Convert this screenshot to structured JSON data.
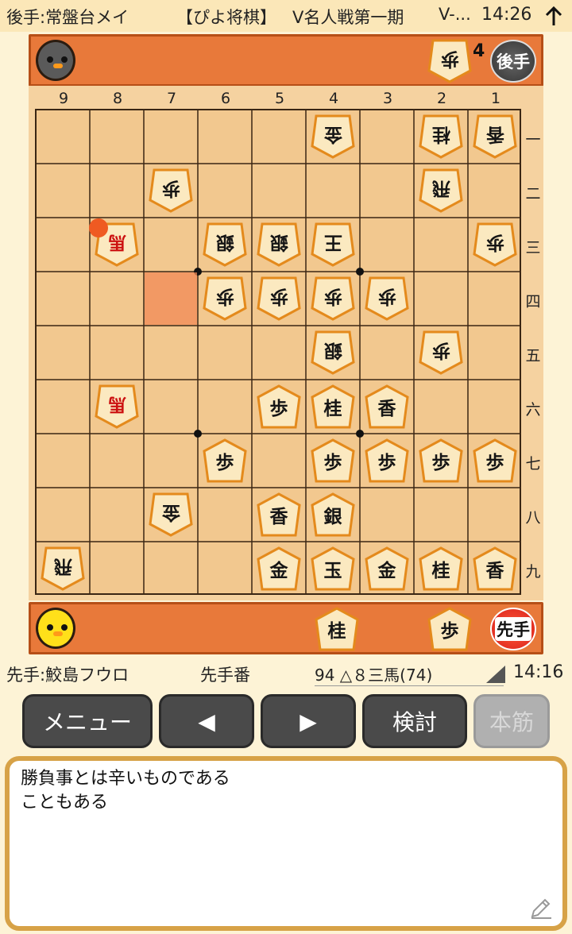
{
  "status_bar": {
    "gote_player": "後手:常盤台メイ",
    "app_title": "【ぴよ将棋】",
    "event": "V名人戦第一期",
    "event_trunc": "V-...",
    "time": "14:26"
  },
  "gote_stand": {
    "badge": "後手",
    "pieces": [
      {
        "label": "歩",
        "count": "4"
      }
    ]
  },
  "sente_stand": {
    "badge": "先手",
    "pieces": [
      {
        "label": "桂",
        "count": ""
      },
      {
        "label": "歩",
        "count": ""
      }
    ]
  },
  "board": {
    "file_labels": [
      "9",
      "8",
      "7",
      "6",
      "5",
      "4",
      "3",
      "2",
      "1"
    ],
    "rank_labels": [
      "一",
      "二",
      "三",
      "四",
      "五",
      "六",
      "七",
      "八",
      "九"
    ],
    "last_move_from": {
      "file": 7,
      "rank": 4
    },
    "last_move_to": {
      "file": 8,
      "rank": 3
    },
    "pieces": [
      {
        "file": 4,
        "rank": 1,
        "label": "金",
        "side": "gote",
        "promoted": false
      },
      {
        "file": 2,
        "rank": 1,
        "label": "桂",
        "side": "gote",
        "promoted": false
      },
      {
        "file": 1,
        "rank": 1,
        "label": "香",
        "side": "gote",
        "promoted": false
      },
      {
        "file": 7,
        "rank": 2,
        "label": "歩",
        "side": "gote",
        "promoted": false
      },
      {
        "file": 2,
        "rank": 2,
        "label": "飛",
        "side": "gote",
        "promoted": false
      },
      {
        "file": 8,
        "rank": 3,
        "label": "馬",
        "side": "gote",
        "promoted": true
      },
      {
        "file": 6,
        "rank": 3,
        "label": "銀",
        "side": "gote",
        "promoted": false
      },
      {
        "file": 5,
        "rank": 3,
        "label": "銀",
        "side": "gote",
        "promoted": false
      },
      {
        "file": 4,
        "rank": 3,
        "label": "王",
        "side": "gote",
        "promoted": false
      },
      {
        "file": 1,
        "rank": 3,
        "label": "歩",
        "side": "gote",
        "promoted": false
      },
      {
        "file": 6,
        "rank": 4,
        "label": "歩",
        "side": "gote",
        "promoted": false
      },
      {
        "file": 5,
        "rank": 4,
        "label": "歩",
        "side": "gote",
        "promoted": false
      },
      {
        "file": 4,
        "rank": 4,
        "label": "歩",
        "side": "gote",
        "promoted": false
      },
      {
        "file": 3,
        "rank": 4,
        "label": "歩",
        "side": "gote",
        "promoted": false
      },
      {
        "file": 4,
        "rank": 5,
        "label": "銀",
        "side": "gote",
        "promoted": false
      },
      {
        "file": 2,
        "rank": 5,
        "label": "歩",
        "side": "gote",
        "promoted": false
      },
      {
        "file": 8,
        "rank": 6,
        "label": "馬",
        "side": "gote",
        "promoted": true
      },
      {
        "file": 5,
        "rank": 6,
        "label": "歩",
        "side": "sente",
        "promoted": false
      },
      {
        "file": 4,
        "rank": 6,
        "label": "桂",
        "side": "sente",
        "promoted": false
      },
      {
        "file": 3,
        "rank": 6,
        "label": "香",
        "side": "sente",
        "promoted": false
      },
      {
        "file": 6,
        "rank": 7,
        "label": "歩",
        "side": "sente",
        "promoted": false
      },
      {
        "file": 4,
        "rank": 7,
        "label": "歩",
        "side": "sente",
        "promoted": false
      },
      {
        "file": 3,
        "rank": 7,
        "label": "歩",
        "side": "sente",
        "promoted": false
      },
      {
        "file": 2,
        "rank": 7,
        "label": "歩",
        "side": "sente",
        "promoted": false
      },
      {
        "file": 1,
        "rank": 7,
        "label": "歩",
        "side": "sente",
        "promoted": false
      },
      {
        "file": 7,
        "rank": 8,
        "label": "金",
        "side": "gote",
        "promoted": false
      },
      {
        "file": 5,
        "rank": 8,
        "label": "香",
        "side": "sente",
        "promoted": false
      },
      {
        "file": 4,
        "rank": 8,
        "label": "銀",
        "side": "sente",
        "promoted": false
      },
      {
        "file": 9,
        "rank": 9,
        "label": "飛",
        "side": "gote",
        "promoted": false
      },
      {
        "file": 5,
        "rank": 9,
        "label": "金",
        "side": "sente",
        "promoted": false
      },
      {
        "file": 4,
        "rank": 9,
        "label": "玉",
        "side": "sente",
        "promoted": false
      },
      {
        "file": 3,
        "rank": 9,
        "label": "金",
        "side": "sente",
        "promoted": false
      },
      {
        "file": 2,
        "rank": 9,
        "label": "桂",
        "side": "sente",
        "promoted": false
      },
      {
        "file": 1,
        "rank": 9,
        "label": "香",
        "side": "sente",
        "promoted": false
      }
    ]
  },
  "info_bar": {
    "sente_player": "先手:鮫島フウロ",
    "turn": "先手番",
    "move": "94 △８三馬(74)",
    "elapsed": "14:16"
  },
  "buttons": {
    "menu": "メニュー",
    "back": "◀",
    "forward": "▶",
    "analyze": "検討",
    "mainline": "本筋"
  },
  "comment": {
    "line1": "勝負事とは辛いものである",
    "line2": "こともある"
  },
  "colors": {
    "board": "#f2c88f",
    "stand": "#e8793a",
    "highlight": "#f28a55",
    "last_move_dot": "#ef5a22",
    "promoted_text": "#cc1111"
  }
}
